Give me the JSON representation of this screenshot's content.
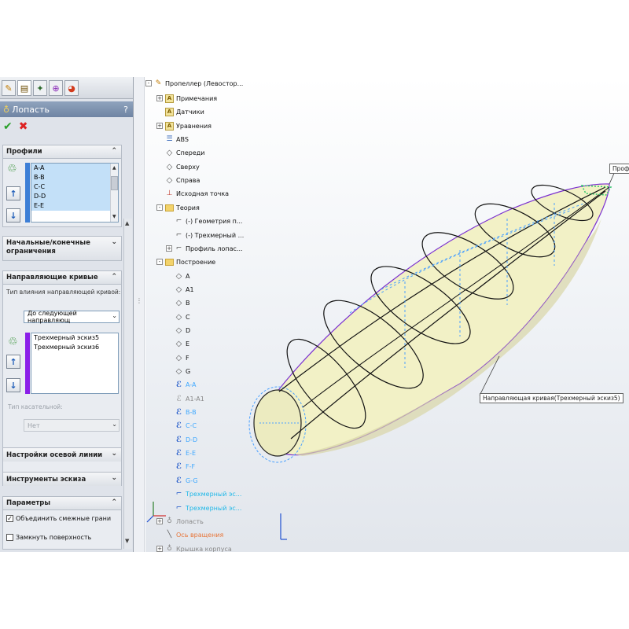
{
  "pm": {
    "tabs": [
      "feature-manager-icon",
      "property-manager-icon",
      "configuration-manager-icon",
      "dim-xpert-icon",
      "display-manager-icon"
    ],
    "title": "Лопасть",
    "help": "?",
    "profiles": {
      "header": "Профили",
      "items": [
        "A-A",
        "B-B",
        "C-C",
        "D-D",
        "E-E"
      ]
    },
    "start_end": {
      "header": "Начальные/конечные ограничения"
    },
    "guides": {
      "header": "Направляющие кривые",
      "influence_label": "Тип влияния направляющей кривой:",
      "influence_value": "До следующей направляющ",
      "items": [
        "Трехмерный эскиз5",
        "Трехмерный эскиз6"
      ],
      "tangency_label": "Тип касательной:",
      "tangency_value": "Нет"
    },
    "centerline": {
      "header": "Настройки осевой линии"
    },
    "sketch_tools": {
      "header": "Инструменты эскиза"
    },
    "options": {
      "header": "Параметры",
      "merge_faces": "Объединить смежные грани",
      "merge_checked": true,
      "close_loft": "Замкнуть поверхность",
      "close_checked": false
    }
  },
  "tree": {
    "root": "Пропеллер (Левостор...",
    "items": [
      {
        "label": "Примечания",
        "icon": "annotations-icon",
        "kind": "doc",
        "expand": "+"
      },
      {
        "label": "Датчики",
        "icon": "sensors-icon",
        "kind": "doc",
        "expand": ""
      },
      {
        "label": "Уравнения",
        "icon": "equations-icon",
        "kind": "doc",
        "expand": "+"
      },
      {
        "label": "ABS",
        "icon": "material-icon",
        "kind": "material",
        "expand": ""
      },
      {
        "label": "Спереди",
        "icon": "plane-icon",
        "kind": "plane",
        "expand": ""
      },
      {
        "label": "Сверху",
        "icon": "plane-icon",
        "kind": "plane",
        "expand": ""
      },
      {
        "label": "Справа",
        "icon": "plane-icon",
        "kind": "plane",
        "expand": ""
      },
      {
        "label": "Исходная точка",
        "icon": "origin-icon",
        "kind": "origin",
        "expand": ""
      },
      {
        "label": "Теория",
        "icon": "folder-icon",
        "kind": "folder",
        "expand": "-"
      },
      {
        "label": "(-) Геометрия п...",
        "icon": "sketch-icon",
        "kind": "sketch",
        "expand": "",
        "indent": 1
      },
      {
        "label": "(-) Трехмерный ...",
        "icon": "sketch-3d-icon",
        "kind": "sketch",
        "expand": "",
        "indent": 1
      },
      {
        "label": "Профиль лопас...",
        "icon": "sketch-icon",
        "kind": "sketch",
        "expand": "+",
        "indent": 1
      },
      {
        "label": "Построение",
        "icon": "folder-icon",
        "kind": "folder",
        "expand": "-"
      },
      {
        "label": "A",
        "icon": "plane-icon",
        "kind": "plane",
        "expand": "",
        "indent": 1
      },
      {
        "label": "A1",
        "icon": "plane-icon",
        "kind": "plane",
        "expand": "",
        "indent": 1
      },
      {
        "label": "B",
        "icon": "plane-icon",
        "kind": "plane",
        "expand": "",
        "indent": 1
      },
      {
        "label": "C",
        "icon": "plane-icon",
        "kind": "plane",
        "expand": "",
        "indent": 1
      },
      {
        "label": "D",
        "icon": "plane-icon",
        "kind": "plane",
        "expand": "",
        "indent": 1
      },
      {
        "label": "E",
        "icon": "plane-icon",
        "kind": "plane",
        "expand": "",
        "indent": 1
      },
      {
        "label": "F",
        "icon": "plane-icon",
        "kind": "plane",
        "expand": "",
        "indent": 1
      },
      {
        "label": "G",
        "icon": "plane-icon",
        "kind": "plane",
        "expand": "",
        "indent": 1
      },
      {
        "label": "A-A",
        "icon": "sketch-blue-icon",
        "kind": "sel-sketch",
        "expand": "",
        "indent": 1
      },
      {
        "label": "A1-A1",
        "icon": "sketch-grey-icon",
        "kind": "grey-sketch",
        "expand": "",
        "indent": 1
      },
      {
        "label": "B-B",
        "icon": "sketch-blue-icon",
        "kind": "sel-sketch",
        "expand": "",
        "indent": 1
      },
      {
        "label": "C-C",
        "icon": "sketch-blue-icon",
        "kind": "sel-sketch",
        "expand": "",
        "indent": 1
      },
      {
        "label": "D-D",
        "icon": "sketch-blue-icon",
        "kind": "sel-sketch",
        "expand": "",
        "indent": 1
      },
      {
        "label": "E-E",
        "icon": "sketch-blue-icon",
        "kind": "sel-sketch",
        "expand": "",
        "indent": 1
      },
      {
        "label": "F-F",
        "icon": "sketch-blue-icon",
        "kind": "sel-sketch",
        "expand": "",
        "indent": 1
      },
      {
        "label": "G-G",
        "icon": "sketch-blue-icon",
        "kind": "sel-sketch",
        "expand": "",
        "indent": 1
      },
      {
        "label": "Трехмерный эс...",
        "icon": "sketch-3d-icon",
        "kind": "cyan-sketch",
        "expand": "",
        "indent": 1
      },
      {
        "label": "Трехмерный эс...",
        "icon": "sketch-3d-icon",
        "kind": "cyan-sketch",
        "expand": "",
        "indent": 1
      },
      {
        "label": "Лопасть",
        "icon": "loft-icon",
        "kind": "grey-feature",
        "expand": "+"
      },
      {
        "label": "Ось вращения",
        "icon": "axis-icon",
        "kind": "axis",
        "expand": ""
      },
      {
        "label": "Крышка корпуса",
        "icon": "feature-icon",
        "kind": "grey-feature",
        "expand": "+"
      }
    ]
  },
  "callouts": {
    "profile": "Профи",
    "guide": "Направляющая кривая(Трехмерный эскиз5)"
  },
  "colors": {
    "surface": "#f2f1c6",
    "profile_line": "#111111",
    "guide_line": "#7a2fd0",
    "sketch_blue": "#4aa0ff",
    "accent_purple": "#8b1fe8"
  }
}
